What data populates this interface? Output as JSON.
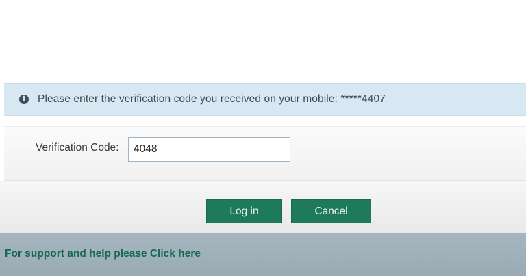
{
  "info_banner": {
    "icon": "info-circle-icon",
    "text": "Please enter the verification code you received on your mobile: *****4407"
  },
  "verification": {
    "label": "Verification Code:",
    "value": "4048"
  },
  "buttons": {
    "login_label": "Log in",
    "cancel_label": "Cancel"
  },
  "footer": {
    "support_text": "For support and help please Click here"
  },
  "colors": {
    "button_green": "#1e7a5a",
    "banner_blue": "#d8e8f2",
    "link_green": "#14694f",
    "footer_gray": "#a6b6bf"
  }
}
